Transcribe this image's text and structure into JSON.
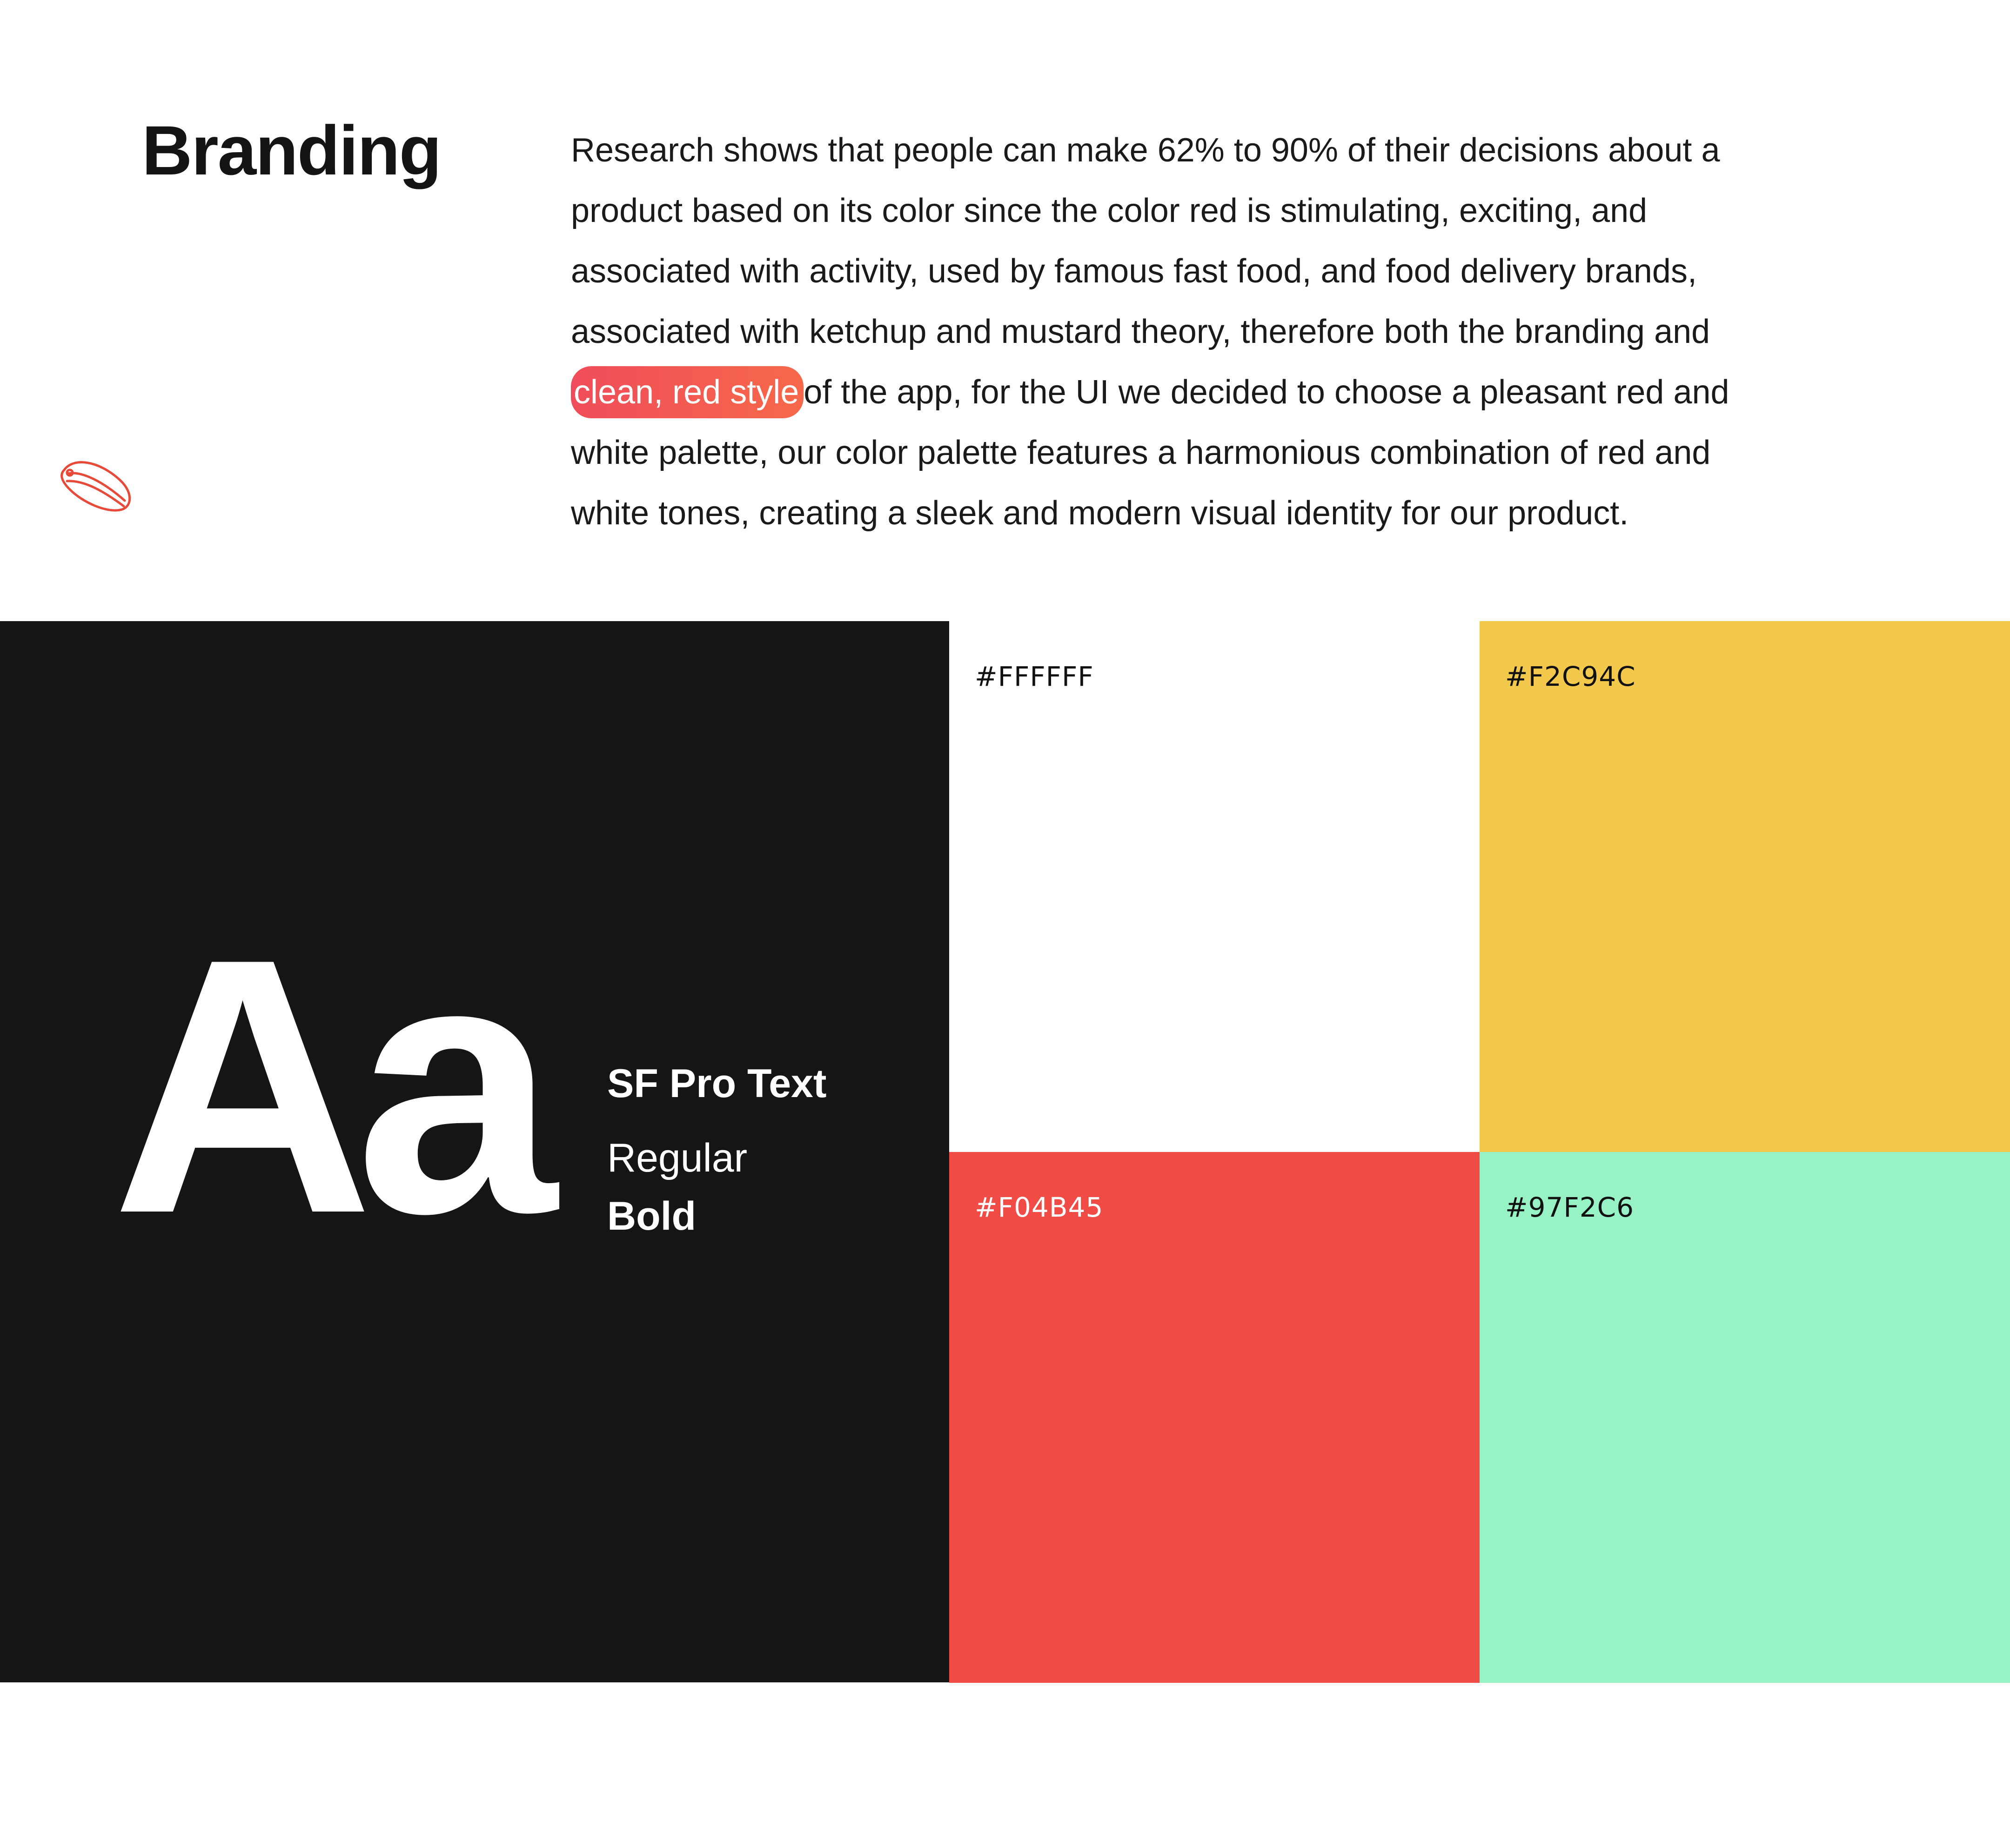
{
  "header": {
    "title": "Branding"
  },
  "description": {
    "line1": "Research shows that people can make 62% to 90% of their decisions about a",
    "line2": "product based on its color since the color red is stimulating, exciting, and",
    "line3": "associated with activity, used by famous fast food, and food delivery brands,",
    "line4": "associated with ketchup and mustard theory,  therefore both the branding and",
    "highlight": "clean, red style",
    "line5_rest": "of the app, for the UI we decided to choose a pleasant red and",
    "line6": "white palette, our color palette features a harmonious combination of red and",
    "line7": "white tones, creating a sleek and modern visual identity for our product."
  },
  "logo": {
    "icon": "hotdog-icon",
    "color": "#E84A3A"
  },
  "typography": {
    "sample": "Aa",
    "font_name": "SF Pro Text",
    "weight_regular": "Regular",
    "weight_bold": "Bold",
    "background": "#151515"
  },
  "palette": [
    {
      "code": "#FFFFFF",
      "color": "#FFFFFF",
      "text_color": "#111111"
    },
    {
      "code": "#F2C94C",
      "color": "#F2C94C",
      "text_color": "#111111"
    },
    {
      "code": "#F04B45",
      "color": "#F04B45",
      "text_color": "#FFFFFF"
    },
    {
      "code": "#97F2C6",
      "color": "#97F2C6",
      "text_color": "#111111"
    }
  ]
}
